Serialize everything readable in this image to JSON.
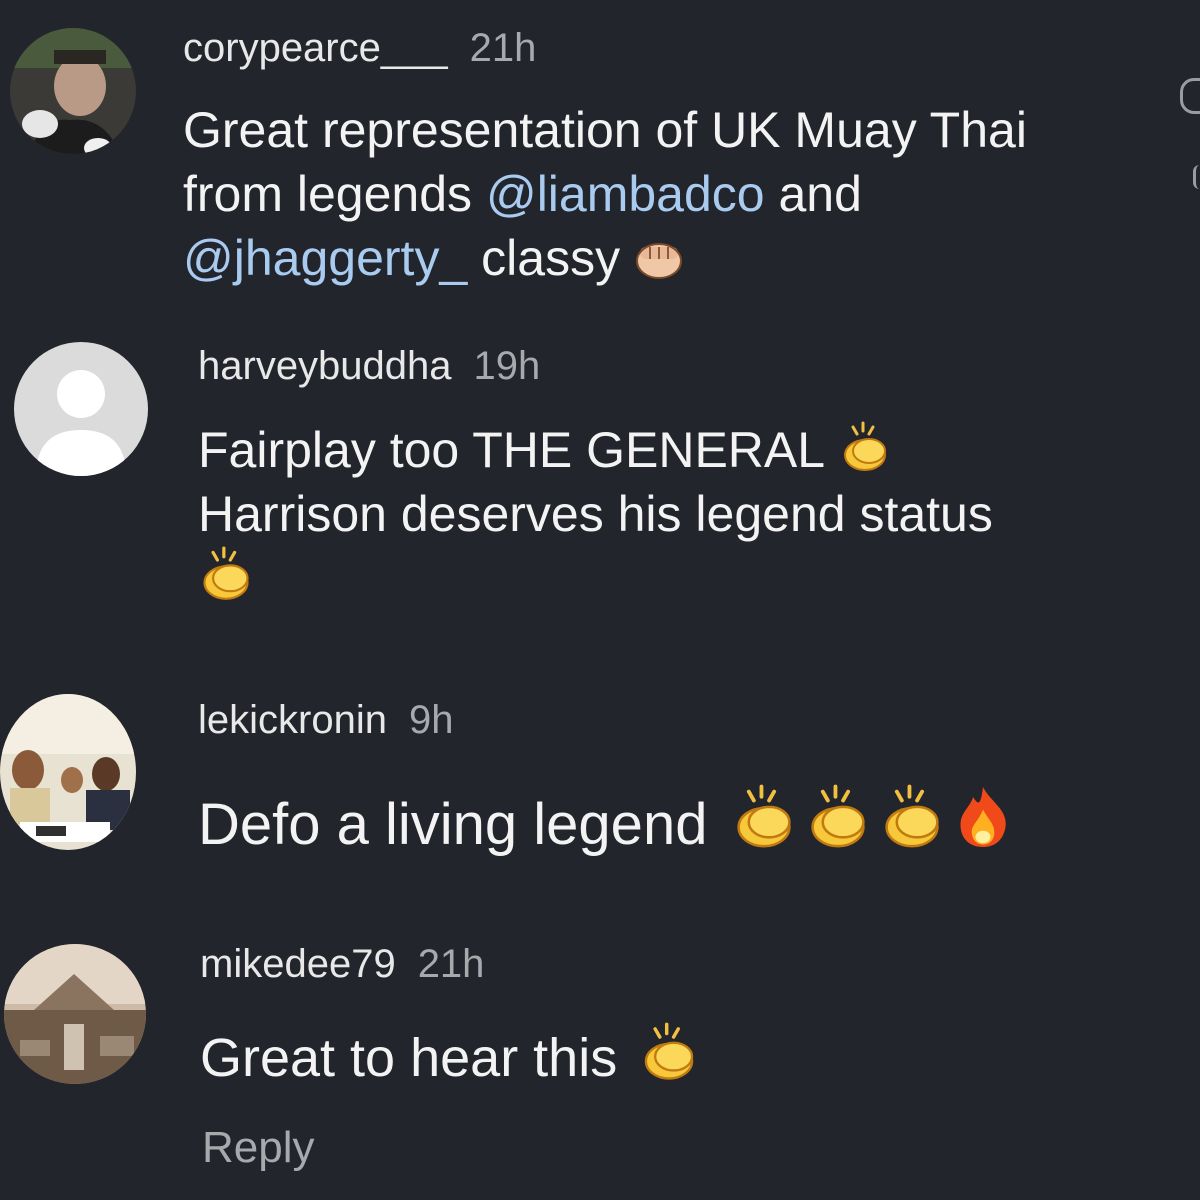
{
  "comments": [
    {
      "username": "corypearce___",
      "time": "21h",
      "lines": [
        [
          {
            "t": "Great representation of UK Muay Thai"
          }
        ],
        [
          {
            "t": "from legends "
          },
          {
            "t": "@liambadco",
            "mention": true
          },
          {
            "t": "  and"
          }
        ],
        [
          {
            "t": "@jhaggerty_",
            "mention": true
          },
          {
            "t": "  classy"
          }
        ]
      ],
      "emoji_after_line3": "fist-icon",
      "avatar": "photo-avatar"
    },
    {
      "username": "harveybuddha",
      "time": "19h",
      "lines": [
        [
          {
            "t": "Fairplay too THE GENERAL"
          }
        ],
        [
          {
            "t": "Harrison  deserves his legend status"
          }
        ]
      ],
      "avatar": "default-avatar"
    },
    {
      "username": "lekickronin",
      "time": "9h",
      "lines": [
        [
          {
            "t": "Defo a living legend"
          }
        ]
      ],
      "avatar": "photo-avatar"
    },
    {
      "username": "mikedee79",
      "time": "21h",
      "lines": [
        [
          {
            "t": "Great to hear this"
          }
        ]
      ],
      "avatar": "photo-avatar"
    }
  ],
  "reply_label": "Reply",
  "icons": {
    "fist": "oncoming-fist-emoji",
    "clap": "clapping-hands-emoji",
    "fire": "fire-emoji"
  },
  "colors": {
    "background": "#23252c",
    "mention": "#a9cbf0",
    "secondary": "#a7a9ad"
  }
}
